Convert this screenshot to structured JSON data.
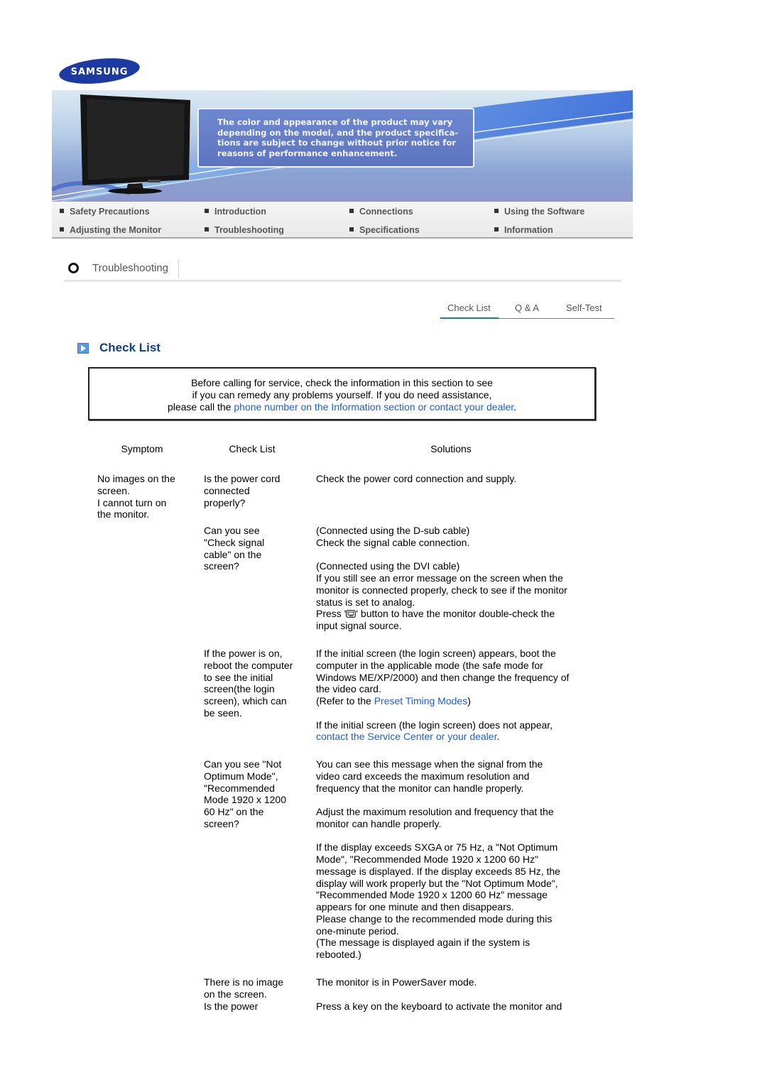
{
  "brand": {
    "logo_text": "SAMSUNG",
    "logo_color": "#1428a0"
  },
  "banner": {
    "notice_lines": [
      "The color and appearance of the product may vary",
      "depending on the model, and the product specifica-",
      "tions are subject to change without prior notice for",
      "reasons of performance enhancement."
    ]
  },
  "nav": {
    "items": [
      {
        "label": "Safety Precautions"
      },
      {
        "label": "Introduction"
      },
      {
        "label": "Connections"
      },
      {
        "label": "Using the Software"
      },
      {
        "label": "Adjusting the Monitor"
      },
      {
        "label": "Troubleshooting"
      },
      {
        "label": "Specifications"
      },
      {
        "label": "Information"
      }
    ]
  },
  "section": {
    "title": "Troubleshooting"
  },
  "tabs": [
    {
      "label": "Check List",
      "active": true
    },
    {
      "label": "Q & A",
      "active": false
    },
    {
      "label": "Self-Test",
      "active": false
    }
  ],
  "checklist": {
    "title": "Check List",
    "intro": {
      "line1": "Before calling for service, check the information in this section to see",
      "line2": "if you can remedy any problems yourself. If you do need assistance,",
      "line3_prefix": "please call the ",
      "line3_link": "phone number on the Information section or contact your dealer",
      "line3_suffix": "."
    },
    "headers": {
      "symptom": "Symptom",
      "check": "Check List",
      "solutions": "Solutions"
    },
    "symptom_lines": [
      "No images on the",
      "screen.",
      "I cannot turn on",
      "the monitor."
    ],
    "rows": [
      {
        "check_lines": [
          "Is the power cord",
          "connected",
          "properly?"
        ],
        "solution_lines": [
          "Check the power cord connection and supply."
        ]
      },
      {
        "check_lines": [
          "Can you see",
          "\"Check signal",
          "cable\" on the",
          "screen?"
        ],
        "solution_lines_a": [
          "(Connected using the D-sub cable)",
          "Check the signal cable connection."
        ],
        "solution_lines_b": [
          "(Connected using the DVI cable)",
          "If you still see an error message on the screen when the",
          "monitor is connected properly, check to see if the monitor",
          "status is set to analog."
        ],
        "press_prefix": "Press '",
        "press_icon": "source-enter-icon",
        "press_suffix": "' button to have the monitor double-check the",
        "press_last": "input signal source."
      },
      {
        "check_lines": [
          "If the power is on,",
          "reboot the computer",
          "to see the initial",
          "screen(the login",
          "screen), which can",
          "be seen."
        ],
        "solution_lines_a": [
          "If the initial screen (the login screen) appears, boot the",
          "computer in the applicable mode (the safe mode for",
          "Windows ME/XP/2000) and then change the frequency of",
          "the video card."
        ],
        "refer_prefix": "(Refer to the ",
        "refer_link": "Preset Timing Modes",
        "refer_suffix": ")",
        "solution_b_line": "If the initial screen (the login screen) does not appear,",
        "contact_link": "contact the Service Center or your dealer",
        "contact_suffix": "."
      },
      {
        "check_lines": [
          "Can you see \"Not",
          "Optimum Mode\",",
          "\"Recommended",
          "Mode 1920 x 1200",
          "60 Hz\" on the",
          "screen?"
        ],
        "solution_lines_a": [
          "You can see this message when the signal from the",
          "video card exceeds the maximum resolution and",
          "frequency that the monitor can handle properly."
        ],
        "solution_lines_b": [
          "Adjust the maximum resolution and frequency that the",
          "monitor can handle properly."
        ],
        "solution_lines_c": [
          "If the display exceeds SXGA or 75 Hz, a \"Not Optimum",
          "Mode\", \"Recommended Mode 1920 x 1200 60 Hz\"",
          "message is displayed. If the display exceeds 85 Hz, the",
          "display will work properly but the \"Not Optimum Mode\",",
          "\"Recommended Mode 1920 x 1200 60 Hz\" message",
          "appears for one minute and then disappears.",
          "Please change to the recommended mode during this",
          "one-minute period.",
          "(The message is displayed again if the system is",
          "rebooted.)"
        ]
      },
      {
        "check_lines": [
          "There is no image",
          "on the screen.",
          "Is the power"
        ],
        "solution_lines_a": [
          "The monitor is in PowerSaver mode."
        ],
        "solution_lines_b": [
          "Press a key on the keyboard to activate the monitor and"
        ]
      }
    ]
  }
}
